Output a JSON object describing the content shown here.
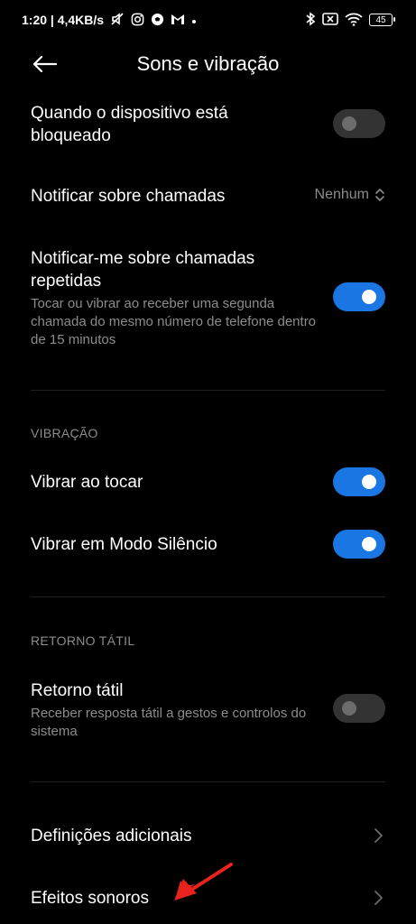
{
  "status_bar": {
    "time_speed": "1:20 | 4,4KB/s",
    "battery": "45"
  },
  "header": {
    "title": "Sons e vibração"
  },
  "rows": {
    "locked": {
      "title": "Quando o dispositivo está bloqueado",
      "enabled": false
    },
    "notify_calls": {
      "title": "Notificar sobre chamadas",
      "value": "Nenhum"
    },
    "repeated_calls": {
      "title": "Notificar-me sobre chamadas repetidas",
      "subtitle": "Tocar ou vibrar ao receber uma segunda chamada do mesmo número de telefone dentro de 15 minutos",
      "enabled": true
    },
    "vibrate_ring": {
      "title": "Vibrar ao tocar",
      "enabled": true
    },
    "vibrate_silent": {
      "title": "Vibrar em Modo Silêncio",
      "enabled": true
    },
    "haptic": {
      "title": "Retorno tátil",
      "subtitle": "Receber resposta tátil a gestos e controlos do sistema",
      "enabled": false
    },
    "additional": {
      "title": "Definições adicionais"
    },
    "sound_effects": {
      "title": "Efeitos sonoros"
    }
  },
  "sections": {
    "vibration": "VIBRAÇÃO",
    "haptic": "RETORNO TÁTIL"
  },
  "colors": {
    "accent": "#1976e3",
    "annotation": "#e8231e"
  }
}
